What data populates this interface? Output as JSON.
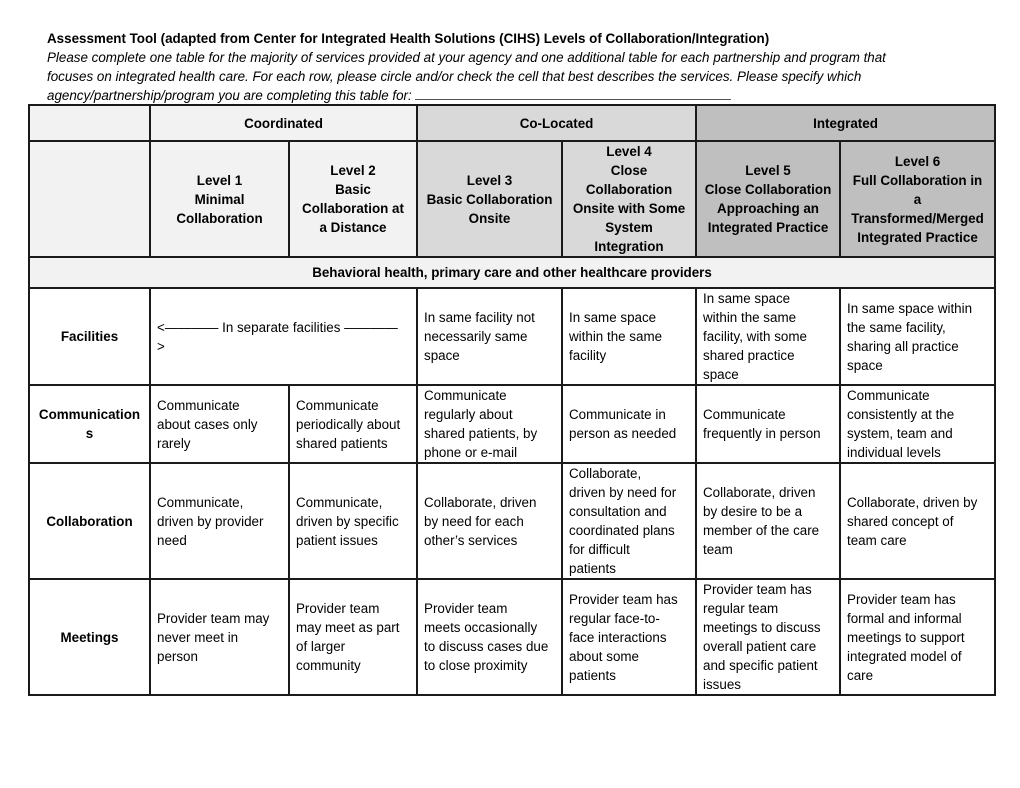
{
  "document": {
    "title": "Assessment Tool (adapted from Center for Integrated Health Solutions (CIHS) Levels of Collaboration/Integration)",
    "instructions_lines": [
      "Please complete one table for the majority of services provided at your agency and one additional table for each partnership and program that",
      "focuses on integrated health care. For each row, please circle and/or check the cell that best describes the services. Please specify which",
      "agency/partnership/program you are completing this table for: "
    ],
    "fill_in_blank": ""
  },
  "table": {
    "groups": [
      {
        "label": "Coordinated"
      },
      {
        "label": "Co-Located"
      },
      {
        "label": "Integrated"
      }
    ],
    "levels": [
      {
        "lines": [
          "Level 1",
          "Minimal",
          "Collaboration"
        ]
      },
      {
        "lines": [
          "Level 2",
          "Basic",
          "Collaboration at",
          "a Distance"
        ]
      },
      {
        "lines": [
          "Level 3",
          "Basic Collaboration",
          "Onsite"
        ]
      },
      {
        "lines": [
          "Level 4",
          "Close",
          "Collaboration",
          "Onsite with Some",
          "System",
          "Integration"
        ]
      },
      {
        "lines": [
          "Level 5",
          "Close Collaboration",
          "Approaching an",
          "Integrated Practice"
        ]
      },
      {
        "lines": [
          "Level 6",
          "Full Collaboration in",
          "a",
          "Transformed/Merged",
          "Integrated Practice"
        ]
      }
    ],
    "section_label": "Behavioral health, primary care and other healthcare providers",
    "rows": [
      {
        "label_lines": [
          "Facilities"
        ],
        "merged_1_2": [
          "<———— In separate facilities ————",
          ">"
        ],
        "cells": [
          [
            "In same facility not",
            "necessarily same",
            "space"
          ],
          [
            "In same space",
            "within the same",
            "facility"
          ],
          [
            "In same space",
            "within the same",
            "facility, with some",
            "shared practice",
            "space"
          ],
          [
            "In same space within",
            "the same facility,",
            "sharing all practice",
            "space"
          ]
        ]
      },
      {
        "label_lines": [
          "Communication",
          "s"
        ],
        "cells": [
          [
            "Communicate",
            "about cases only",
            "rarely"
          ],
          [
            "Communicate",
            "periodically about",
            "shared patients"
          ],
          [
            "Communicate",
            "regularly about",
            "shared patients, by",
            "phone or e-mail"
          ],
          [
            "Communicate in",
            "person as needed"
          ],
          [
            "Communicate",
            "frequently in person"
          ],
          [
            "Communicate",
            "consistently at the",
            "system, team and",
            "individual levels"
          ]
        ]
      },
      {
        "label_lines": [
          "Collaboration"
        ],
        "cells": [
          [
            "Communicate,",
            "driven by provider",
            "need"
          ],
          [
            "Communicate,",
            "driven by specific",
            "patient issues"
          ],
          [
            "Collaborate, driven",
            "by need for each",
            "other’s services"
          ],
          [
            "Collaborate,",
            "driven by need for",
            "consultation and",
            "coordinated plans",
            "for difficult",
            "patients"
          ],
          [
            "Collaborate, driven",
            "by desire to be a",
            "member of the care",
            "team"
          ],
          [
            "Collaborate, driven by",
            "shared concept of",
            "team care"
          ]
        ]
      },
      {
        "label_lines": [
          "Meetings"
        ],
        "cells": [
          [
            "Provider team may",
            "never meet in",
            "person"
          ],
          [
            "Provider team",
            "may meet as part",
            "of larger",
            "community"
          ],
          [
            "Provider team",
            "meets occasionally",
            "to discuss cases due",
            "to close proximity"
          ],
          [
            "Provider team has",
            "regular face-to-",
            "face interactions",
            "about some",
            "patients"
          ],
          [
            "Provider team has",
            "regular team",
            "meetings to discuss",
            "overall patient care",
            "and specific patient",
            "issues"
          ],
          [
            "Provider team has",
            "formal and informal",
            "meetings to support",
            "integrated model of",
            "care"
          ]
        ]
      }
    ]
  },
  "colors": {
    "light_header": "#f2f2f2",
    "mid_header": "#d9d9d9",
    "dark_header": "#bfbfbf",
    "border": "#1a1a1a"
  }
}
